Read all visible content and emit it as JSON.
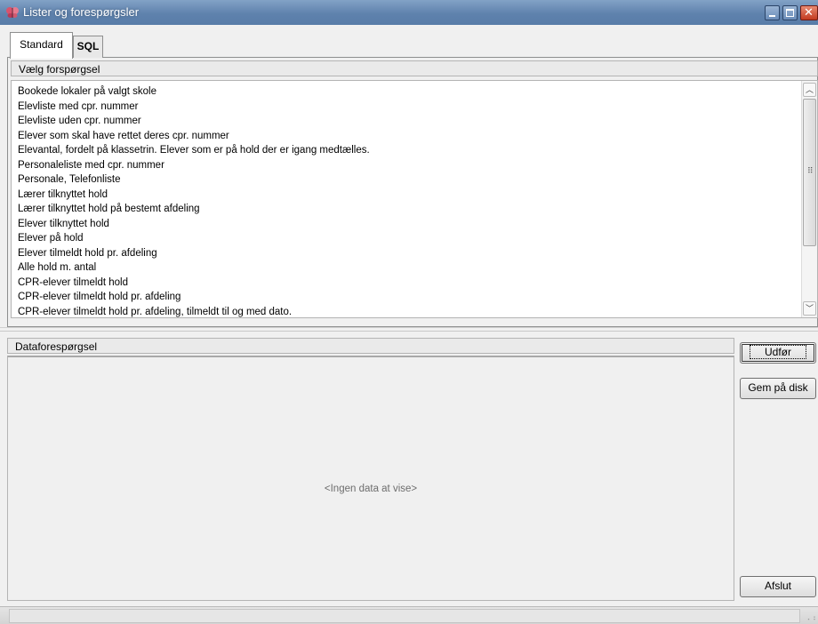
{
  "window": {
    "title": "Lister og forespørgsler",
    "icon": "app-butterfly-icon"
  },
  "tabs": [
    {
      "label": "Standard",
      "active": true
    },
    {
      "label": "SQL",
      "active": false
    }
  ],
  "query_section": {
    "header": "Vælg forspørgsel",
    "items": [
      "Bookede lokaler på valgt skole",
      "Elevliste med cpr. nummer",
      "Elevliste uden cpr. nummer",
      "Elever som skal have rettet deres cpr. nummer",
      "Elevantal, fordelt på klassetrin. Elever som er på hold der er igang medtælles.",
      "Personaleliste med cpr. nummer",
      "Personale, Telefonliste",
      "Lærer tilknyttet hold",
      "Lærer tilknyttet hold på bestemt afdeling",
      "Elever tilknyttet hold",
      "Elever på hold",
      "Elever tilmeldt hold pr. afdeling",
      "Alle hold m. antal",
      "CPR-elever tilmeldt hold",
      "CPR-elever tilmeldt hold pr. afdeling",
      "CPR-elever tilmeldt hold pr. afdeling, tilmeldt til og med dato."
    ]
  },
  "data_section": {
    "header": "Dataforespørgsel",
    "empty_message": "<Ingen data at vise>"
  },
  "buttons": {
    "execute_label": "Udfør",
    "save_label": "Gem på disk",
    "close_label": "Afslut"
  },
  "colors": {
    "titlebar": "#5f82ad",
    "close_button": "#c23a20"
  }
}
